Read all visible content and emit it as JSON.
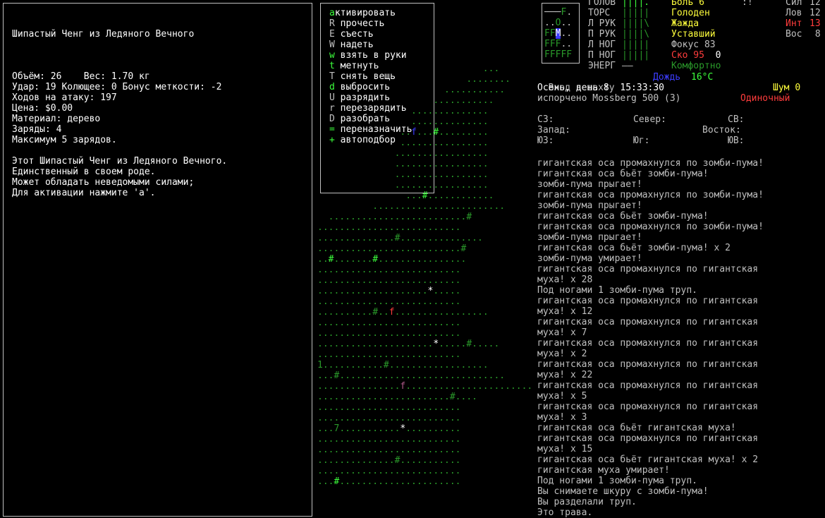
{
  "item": {
    "title": "Шипастый Ченг из Ледяного Вечного",
    "lines": [
      "",
      "Объём: 26    Вес: 1.70 кг",
      "Удар: 19 Колющее: 0 Бонус меткости: -2",
      "Ходов на атаку: 197",
      "Цена: $0.00",
      "Материал: дерево",
      "Заряды: 4",
      "Максимум 5 зарядов.",
      "",
      "Этот Шипастый Ченг из Ледяного Вечного.",
      "Единственный в своем роде.",
      "Может обладать неведомыми силами;",
      "Для активации нажмите 'a'."
    ]
  },
  "menu": [
    {
      "key": "a",
      "label": "ктивировать",
      "key_color": "#3cff3c"
    },
    {
      "key": "R",
      "label": " прочесть",
      "key_color": "#c0c0c0"
    },
    {
      "key": "E",
      "label": " съесть",
      "key_color": "#c0c0c0"
    },
    {
      "key": "W",
      "label": " надеть",
      "key_color": "#c0c0c0"
    },
    {
      "key": "w",
      "label": " взять в руки",
      "key_color": "#3cff3c"
    },
    {
      "key": "t",
      "label": " метнуть",
      "key_color": "#3cff3c"
    },
    {
      "key": "T",
      "label": " снять вещь",
      "key_color": "#c0c0c0"
    },
    {
      "key": "d",
      "label": " выбросить",
      "key_color": "#3cff3c"
    },
    {
      "key": "U",
      "label": " разрядить",
      "key_color": "#c0c0c0"
    },
    {
      "key": "r",
      "label": " перезарядить",
      "key_color": "#c0c0c0"
    },
    {
      "key": "D",
      "label": " разобрать",
      "key_color": "#c0c0c0"
    },
    {
      "key": "=",
      "label": " переназначить",
      "key_color": "#3cff3c"
    },
    {
      "key": "+",
      "label": " автоподбор",
      "key_color": "#3cff3c"
    }
  ],
  "limbs": [
    [
      {
        "t": "───",
        "c": "#c0c0c0"
      },
      {
        "t": "F",
        "c": "#2a9a2a"
      },
      {
        "t": ".",
        "c": "#c0c0c0"
      }
    ],
    [
      {
        "t": "..",
        "c": "#c0c0c0"
      },
      {
        "t": "O",
        "c": "#2a9a2a"
      },
      {
        "t": "..",
        "c": "#c0c0c0"
      }
    ],
    [
      {
        "t": "FF",
        "c": "#2a9a2a"
      },
      {
        "t": "M",
        "c": "#ffffff",
        "bg": "#3c3cff"
      },
      {
        "t": "..",
        "c": "#c0c0c0"
      }
    ],
    [
      {
        "t": "FFF",
        "c": "#2a9a2a"
      },
      {
        "t": "..",
        "c": "#c0c0c0"
      }
    ],
    [
      {
        "t": "FFFFF",
        "c": "#2a9a2a"
      }
    ]
  ],
  "body_parts": [
    {
      "name": "ГОЛОВ",
      "bar": "||||.",
      "bar_color": "#3cff3c"
    },
    {
      "name": "ТОРС",
      "bar": "|||||",
      "bar_color": "#2a9a2a"
    },
    {
      "name": "Л РУК",
      "bar": "||||\\",
      "bar_color": "#2a9a2a"
    },
    {
      "name": "П РУК",
      "bar": "||||\\",
      "bar_color": "#2a9a2a"
    },
    {
      "name": "Л НОГ",
      "bar": "|||||",
      "bar_color": "#2a9a2a"
    },
    {
      "name": "П НОГ",
      "bar": "|||||",
      "bar_color": "#2a9a2a"
    },
    {
      "name": "ЭНЕРГ",
      "bar": "——",
      "bar_color": "#c0c0c0"
    }
  ],
  "statuses": [
    {
      "text": "Боль 6",
      "color": "#ffff3c"
    },
    {
      "text": "Голоден",
      "color": "#ffff3c"
    },
    {
      "text": "Жажда",
      "color": "#ffff3c"
    },
    {
      "text": "Уставший",
      "color": "#ffff3c"
    },
    {
      "text": "Фокус 83",
      "color": "#c0c0c0"
    },
    {
      "text": "Ско 95",
      "color": "#ff3c3c",
      "extra": "  0"
    },
    {
      "text": "Комфортно",
      "color": "#2a9a2a"
    }
  ],
  "top_mark": ":!",
  "attributes": [
    {
      "name": "Сил",
      "value": "12",
      "color": "#c0c0c0"
    },
    {
      "name": "Лов",
      "value": "12",
      "color": "#c0c0c0"
    },
    {
      "name": "Инт",
      "value": "13",
      "color": "#ff3c3c"
    },
    {
      "name": "Вос",
      "value": " 8",
      "color": "#c0c0c0"
    }
  ],
  "location": {
    "place": "Вход в шахту",
    "weather_label": "Дождь",
    "temperature": "16°C",
    "date": "Осень, день 8  15:33:30",
    "noise_label": "Шум",
    "noise_value": "0",
    "weapon": "испорчено Mossberg 500 (3)",
    "fire_mode": "Одиночный"
  },
  "compass": [
    [
      {
        "t": "СЗ:",
        "w": 19
      },
      {
        "t": "Север:",
        "w": 18
      },
      {
        "t": "СВ:",
        "w": 0
      }
    ],
    [
      {
        "t": "Запад:",
        "w": 0
      },
      {
        "t": "Восток:",
        "w": 0,
        "right": true
      }
    ],
    [
      {
        "t": "ЮЗ:",
        "w": 19
      },
      {
        "t": "Юг:",
        "w": 18
      },
      {
        "t": "ЮВ:",
        "w": 0
      }
    ]
  ],
  "log": [
    "гигантская оса промахнулся по зомби-пума!",
    "гигантская оса бьёт зомби-пума!",
    "зомби-пума прыгает!",
    "гигантская оса промахнулся по зомби-пума!",
    "зомби-пума прыгает!",
    "гигантская оса бьёт зомби-пума!",
    "гигантская оса промахнулся по зомби-пума!",
    "зомби-пума прыгает!",
    "гигантская оса бьёт зомби-пума! x 2",
    "зомби-пума умирает!",
    "гигантская оса промахнулся по гигантская",
    "муха! x 28",
    "Под ногами 1 зомби-пума труп.",
    "гигантская оса промахнулся по гигантская",
    "муха! x 12",
    "гигантская оса промахнулся по гигантская",
    "муха! x 7",
    "гигантская оса промахнулся по гигантская",
    "муха! x 2",
    "гигантская оса промахнулся по гигантская",
    "муха! x 22",
    "гигантская оса промахнулся по гигантская",
    "муха! x 5",
    "гигантская оса промахнулся по гигантская",
    "муха! x 3",
    "гигантская оса бьёт гигантская муха!",
    "гигантская оса промахнулся по гигантская",
    "муха! x 15",
    "гигантская оса бьёт гигантская муха! x 2",
    "гигантская муха умирает!",
    "Под ногами 1 зомби-пума труп.",
    "Вы снимаете шкуру с зомби-пума!",
    "Вы разделали труп.",
    "Это трава."
  ],
  "map_rows": [
    "",
    "",
    "",
    "",
    "",
    "",
    "                              ...",
    "                           ........",
    "                       ...........",
    "                     ...........",
    "                 ..............",
    "                 ..............",
    "               ..f...#.........",
    "               ................",
    "              .................",
    "              .................",
    "              .................",
    "              .................",
    "                ...#............",
    "          ........................",
    "  .........................#",
    "..........................",
    "..............#...............",
    "..........................#",
    "..#.......#................",
    "..........................",
    "..........................",
    "....................*.....",
    "..........................",
    "..........#..f.................",
    "..........................",
    "..........................",
    ".....................*.....#.....",
    "..........................",
    "1...........#..................",
    "...#..............................",
    "...............f.......................",
    "........................#....",
    "..........................",
    "..........................",
    "...7...........*..........",
    "..........................",
    "..........................",
    "..............#...........",
    "..........................",
    "...#......................"
  ],
  "map_colors": {
    "dot": "#2a9a2a",
    "tree": "#2a9a2a",
    "tree_bright": "#3cff3c",
    "f_red": "#ff3c3c",
    "f_blue": "#3c3cff",
    "f_magenta": "#b05a8a",
    "star": "#ffffff"
  }
}
